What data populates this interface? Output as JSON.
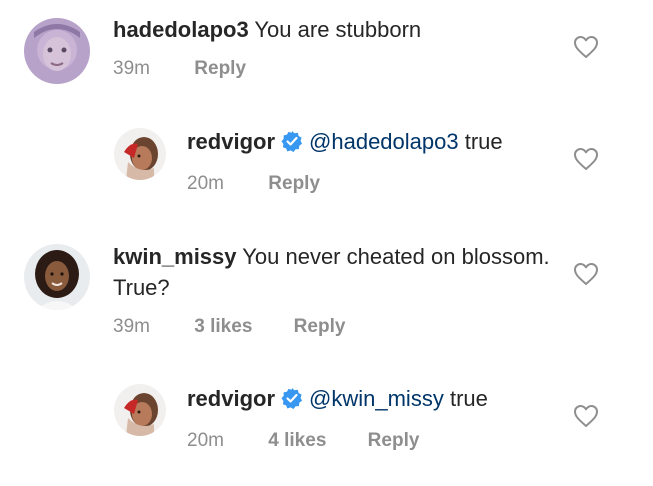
{
  "comments": [
    {
      "username": "hadedolapo3",
      "text": "You are stubborn",
      "time": "39m",
      "reply_label": "Reply"
    },
    {
      "username": "redvigor",
      "mention": "@hadedolapo3",
      "text": "true",
      "time": "20m",
      "reply_label": "Reply"
    },
    {
      "username": "kwin_missy",
      "text": "You never cheated on blossom. True?",
      "time": "39m",
      "likes": "3 likes",
      "reply_label": "Reply"
    },
    {
      "username": "redvigor",
      "mention": "@kwin_missy",
      "text": "true",
      "time": "20m",
      "likes": "4 likes",
      "reply_label": "Reply"
    }
  ],
  "icons": {
    "verified": "verified-badge-icon",
    "like": "heart-outline-icon"
  },
  "colors": {
    "text": "#262626",
    "meta": "#8e8e8e",
    "mention": "#003569",
    "verified": "#3897f0"
  }
}
